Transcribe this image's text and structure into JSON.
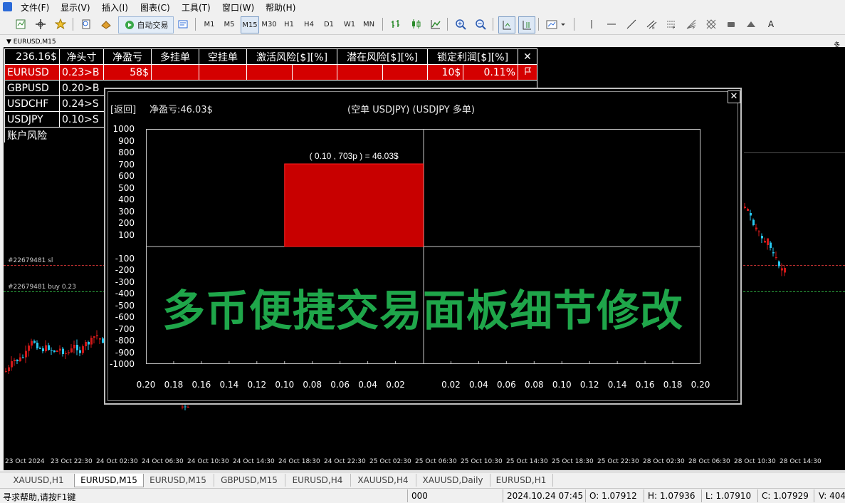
{
  "menu": [
    "文件(F)",
    "显示(V)",
    "插入(I)",
    "图表(C)",
    "工具(T)",
    "窗口(W)",
    "帮助(H)"
  ],
  "toolbar": {
    "autotrade_label": "自动交易",
    "timeframes": [
      "M1",
      "M5",
      "M15",
      "M30",
      "H1",
      "H4",
      "D1",
      "W1",
      "MN"
    ],
    "active_timeframe": "M15"
  },
  "chart": {
    "window_title": "EURUSD,M15",
    "sl_label": "#22679481 sl",
    "buy_label": "#22679481 buy 0.23",
    "right_label": "多",
    "time_labels": [
      "23 Oct 2024",
      "23 Oct 22:30",
      "24 Oct 02:30",
      "24 Oct 06:30",
      "24 Oct 10:30",
      "24 Oct 14:30",
      "24 Oct 18:30",
      "24 Oct 22:30",
      "25 Oct 02:30",
      "25 Oct 06:30",
      "25 Oct 10:30",
      "25 Oct 14:30",
      "25 Oct 18:30",
      "25 Oct 22:30",
      "28 Oct 02:30",
      "28 Oct 06:30",
      "28 Oct 10:30",
      "28 Oct 14:30"
    ]
  },
  "panel": {
    "headers": [
      "236.16$",
      "净头寸",
      "净盈亏",
      "多挂单",
      "空挂单",
      "激活风险[$][%]",
      "潜在风险[$][%]",
      "锁定利润[$][%]"
    ],
    "close_symbol": "✕",
    "rows": [
      {
        "symbol": "EURUSD",
        "position": "0.23>B",
        "pnl": "58$",
        "locked": "10$",
        "locked_pct": "0.11%"
      },
      {
        "symbol": "GBPUSD",
        "position": "0.20>B"
      },
      {
        "symbol": "USDCHF",
        "position": "0.24>S"
      },
      {
        "symbol": "USDJPY",
        "position": "0.10>S"
      }
    ],
    "account_risk_label": "账户风险"
  },
  "popup": {
    "return_label": "[返回]",
    "pnl_text": "净盈亏:46.03$",
    "title": "(空单 USDJPY) (USDJPY 多单)",
    "close_symbol": "✕",
    "bar_annotation": "( 0.10 , 703p ) = 46.03$",
    "bar_color": "#c80000"
  },
  "chart_data": {
    "type": "bar",
    "title": "(空单 USDJPY) (USDJPY 多单)",
    "y_ticks": [
      "1000",
      "900",
      "800",
      "700",
      "600",
      "500",
      "400",
      "300",
      "200",
      "100",
      "-100",
      "-200",
      "-300",
      "-400",
      "-500",
      "-600",
      "-700",
      "-800",
      "-900",
      "-1000"
    ],
    "x_ticks_left": [
      "0.20",
      "0.18",
      "0.16",
      "0.14",
      "0.12",
      "0.10",
      "0.08",
      "0.06",
      "0.04",
      "0.02"
    ],
    "x_ticks_right": [
      "0.02",
      "0.04",
      "0.06",
      "0.08",
      "0.10",
      "0.12",
      "0.14",
      "0.16",
      "0.18",
      "0.20"
    ],
    "ylim": [
      -1000,
      1000
    ],
    "xlim": [
      -0.2,
      0.2
    ],
    "bars": [
      {
        "x_start": -0.1,
        "x_end": 0,
        "y": 703,
        "label": "( 0.10 , 703p ) = 46.03$"
      }
    ]
  },
  "overlay_text": "多币便捷交易面板细节修改",
  "tabs": [
    "XAUUSD,H1",
    "EURUSD,M15",
    "EURUSD,M15",
    "GBPUSD,M15",
    "EURUSD,H4",
    "XAUUSD,H4",
    "XAUUSD,Daily",
    "EURUSD,H1"
  ],
  "active_tab": 1,
  "status": {
    "help": "寻求帮助,请按F1键",
    "profile": "000",
    "datetime": "2024.10.24 07:45",
    "open": "O: 1.07912",
    "high": "H: 1.07936",
    "low": "L: 1.07910",
    "close": "C: 1.07929",
    "volume": "V: 404"
  }
}
